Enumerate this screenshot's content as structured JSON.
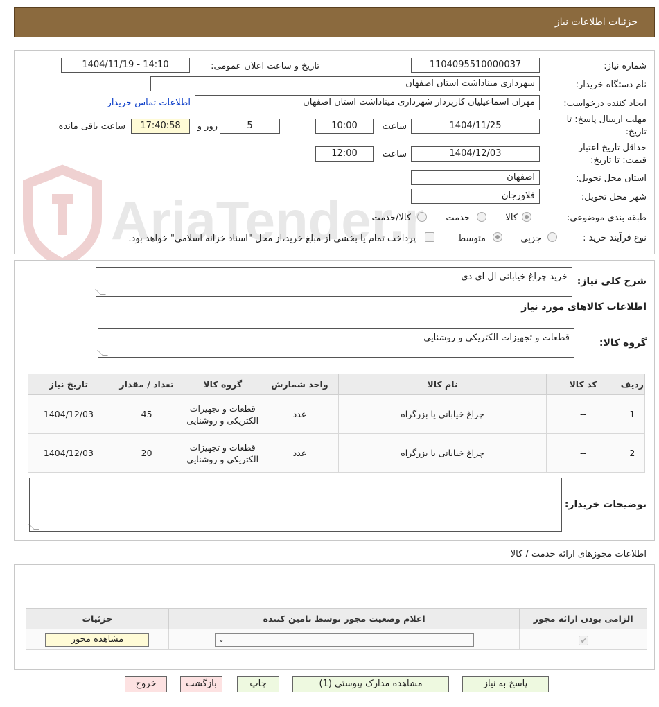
{
  "header": {
    "title": "جزئیات اطلاعات نیاز"
  },
  "form": {
    "need_number_label": "شماره نیاز:",
    "need_number": "1104095510000037",
    "announce_label": "تاریخ و ساعت اعلان عمومی:",
    "announce_value": "1404/11/19 - 14:10",
    "buyer_label": "نام دستگاه خریدار:",
    "buyer_value": "شهرداری میناداشت استان اصفهان",
    "creator_label": "ایجاد کننده درخواست:",
    "creator_value": "مهران اسماعیلیان کارپرداز شهرداری میناداشت استان اصفهان",
    "contact_link": "اطلاعات تماس خریدار",
    "deadline_label_1": "مهلت ارسال پاسخ: تا",
    "deadline_label_2": "تاریخ:",
    "deadline_date": "1404/11/25",
    "time_word": "ساعت",
    "deadline_time": "10:00",
    "days_value": "5",
    "days_word": "روز و",
    "remaining_time": "17:40:58",
    "remaining_word": "ساعت باقی مانده",
    "validity_label_1": "حداقل تاریخ اعتبار",
    "validity_label_2": "قیمت: تا تاریخ:",
    "validity_date": "1404/12/03",
    "validity_time": "12:00",
    "province_label": "استان محل تحویل:",
    "province_value": "اصفهان",
    "city_label": "شهر محل تحویل:",
    "city_value": "فلاورجان",
    "category_label": "طبقه بندی موضوعی:",
    "category_options": [
      "کالا",
      "خدمت",
      "کالا/خدمت"
    ],
    "process_label": "نوع فرآیند خرید :",
    "process_options": [
      "جزیی",
      "متوسط"
    ],
    "payment_note": "پرداخت تمام یا بخشی از مبلغ خرید،از محل \"اسناد خزانه اسلامی\" خواهد بود."
  },
  "description": {
    "label": "شرح کلی نیاز:",
    "value": "خرید چراغ خیابانی ال ای دی"
  },
  "goods": {
    "section_title": "اطلاعات کالاهای مورد نیاز",
    "group_label": "گروه کالا:",
    "group_value": "قطعات و تجهیزات الکتریکی و روشنایی",
    "columns": [
      "ردیف",
      "کد کالا",
      "نام کالا",
      "واحد شمارش",
      "گروه کالا",
      "تعداد / مقدار",
      "تاریخ نیاز"
    ],
    "rows": [
      {
        "idx": "1",
        "code": "--",
        "name": "چراغ خیابانی یا بزرگراه",
        "unit": "عدد",
        "group": "قطعات و تجهیزات الکتریکی و روشنایی",
        "qty": "45",
        "date": "1404/12/03"
      },
      {
        "idx": "2",
        "code": "--",
        "name": "چراغ خیابانی یا بزرگراه",
        "unit": "عدد",
        "group": "قطعات و تجهیزات الکتریکی و روشنایی",
        "qty": "20",
        "date": "1404/12/03"
      }
    ],
    "buyer_notes_label": "توضیحات خریدار:"
  },
  "permits": {
    "title": "اطلاعات مجوزهای ارائه خدمت / کالا",
    "columns": [
      "الزامی بودن ارائه مجوز",
      "اعلام وضعیت مجوز توسط تامین کننده",
      "جزئیات"
    ],
    "select_value": "--",
    "view_button": "مشاهده مجوز"
  },
  "buttons": {
    "reply": "پاسخ به نیاز",
    "attachments": "مشاهده مدارک پیوستی (1)",
    "print": "چاپ",
    "back": "بازگشت",
    "exit": "خروج"
  },
  "watermark": {
    "text": "AriaTender.neT"
  },
  "colors": {
    "header_bg": "#8b6a3e",
    "link": "#0a3cc8",
    "time_bg": "#fffbd6",
    "btn_green": "#eef9e0",
    "btn_pink": "#fde2e2"
  }
}
